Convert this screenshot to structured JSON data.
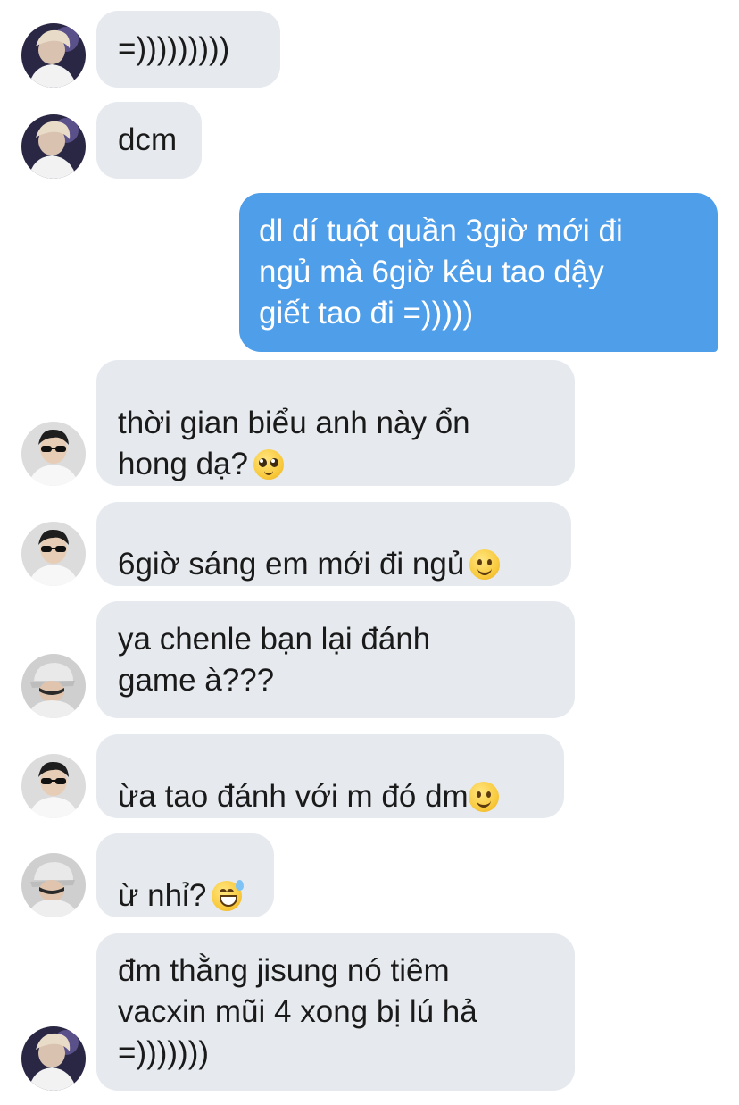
{
  "messages": [
    {
      "id": 1,
      "side": "in",
      "avatar": "avatar-blond",
      "text": "=)))))))))",
      "emoji": ""
    },
    {
      "id": 2,
      "side": "in",
      "avatar": "avatar-blond",
      "text": "dcm",
      "emoji": ""
    },
    {
      "id": 3,
      "side": "out",
      "text": "dl dí tuột quần 3giờ mới đi\nngủ mà 6giờ kêu tao dậy\ngiết tao đi =)))))",
      "emoji": ""
    },
    {
      "id": 4,
      "side": "in",
      "avatar": "avatar-sunglasses",
      "text": "thời gian biểu anh này ổn\nhong dạ?",
      "emoji": "pleading-face-emoji"
    },
    {
      "id": 5,
      "side": "in",
      "avatar": "avatar-sunglasses",
      "text": "6giờ sáng em mới đi ngủ",
      "emoji": "slightly-smiling-face-emoji"
    },
    {
      "id": 6,
      "side": "in",
      "avatar": "avatar-cap",
      "text": "ya chenle bạn lại đánh\ngame à???",
      "emoji": ""
    },
    {
      "id": 7,
      "side": "in",
      "avatar": "avatar-sunglasses",
      "text": "ừa tao đánh với m đó dm",
      "emoji": "slightly-smiling-face-emoji"
    },
    {
      "id": 8,
      "side": "in",
      "avatar": "avatar-cap",
      "text": "ừ nhỉ?",
      "emoji": "grinning-face-with-sweat-emoji"
    },
    {
      "id": 9,
      "side": "in",
      "avatar": "avatar-blond",
      "text": "đm thằng jisung nó tiêm\nvacxin mũi 4 xong bị lú hả\n=)))))))",
      "emoji": ""
    }
  ],
  "colors": {
    "incoming_bubble": "#e6eaee",
    "outgoing_bubble": "#4f9ee9",
    "incoming_text": "#1a1a1a",
    "outgoing_text": "#ffffff"
  }
}
